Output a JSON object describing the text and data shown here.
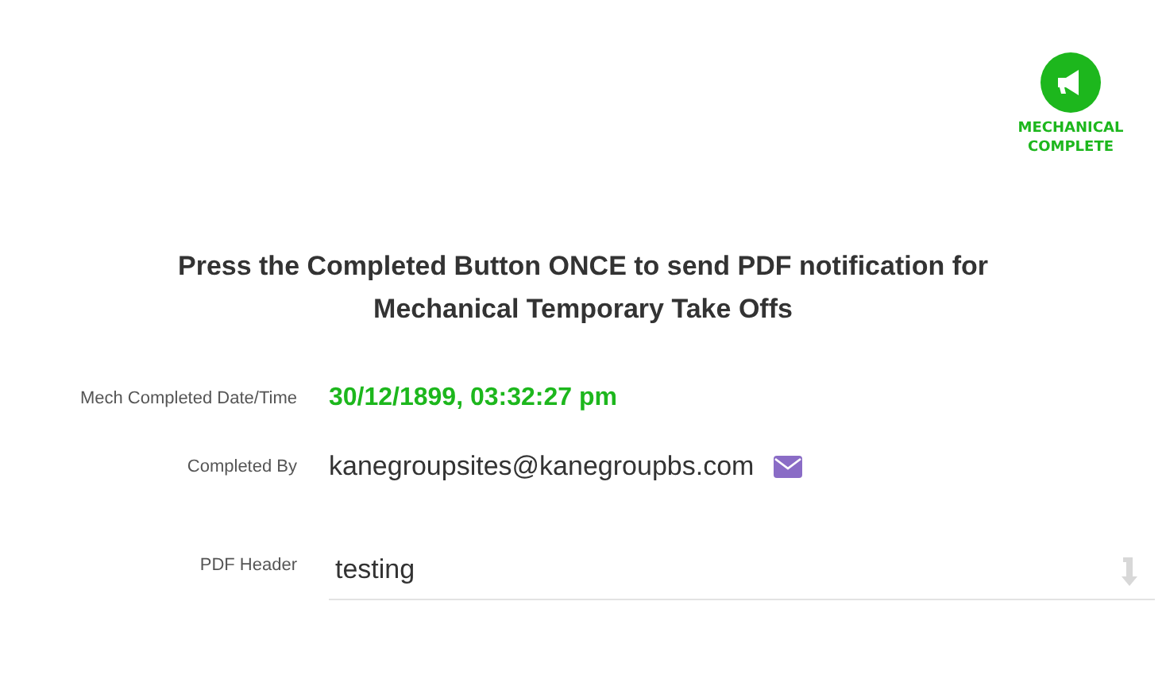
{
  "status_badge": {
    "label": "MECHANICAL COMPLETE"
  },
  "instruction": "Press the Completed Button ONCE to send PDF notification for Mechanical Temporary Take Offs",
  "fields": [
    {
      "kind": "datetime",
      "label": "Mech Completed Date/Time",
      "value": "30/12/1899, 03:32:27 pm"
    },
    {
      "kind": "email",
      "label": "Completed By",
      "value": "kanegroupsites@kanegroupbs.com"
    },
    {
      "kind": "input",
      "label": "PDF Header",
      "value": "testing"
    }
  ]
}
